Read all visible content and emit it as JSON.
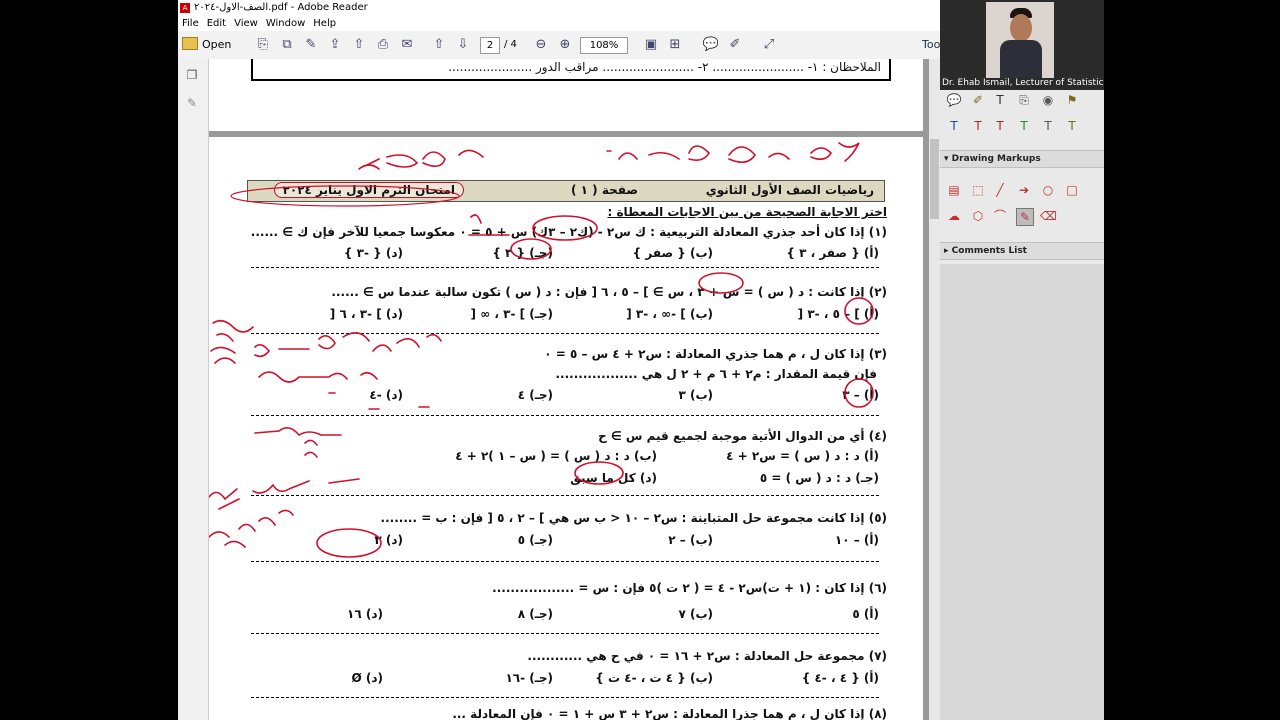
{
  "window": {
    "title": "الصف-الاول-٢٠٢٤.pdf - Adobe Reader"
  },
  "menu": [
    "File",
    "Edit",
    "View",
    "Window",
    "Help"
  ],
  "toolbar": {
    "open_label": "Open",
    "page_current": "2",
    "page_total": "/ 4",
    "zoom": "108%",
    "tools_label": "Too"
  },
  "page1": {
    "notes_line": "الملاحظان : ١- ........................ ٢- ........................      مراقب الدور ......................"
  },
  "exam": {
    "header_subject": "رياضيات الصف الأول الثانوي",
    "header_page": "صفحة ( ١ )",
    "header_title": "امتحان الترم الاول يناير ٢٠٢٤",
    "instruction": "اختر الاجابة الصحيحة من بين الاجابات المعطاة :",
    "questions": [
      {
        "stem": "(١) إذا كان أحد جذري المعادلة التربيعية : ك س٢ - (ك٢ – ٣ك) س + ٥ = ٠ معكوسا جمعيا للآخر فإن ك ∋ ......",
        "options": [
          "(أ) { صفر ، ٣ }",
          "(ب) { صفر }",
          "(جـ) { ٣ }",
          "(د) { -٣ }"
        ]
      },
      {
        "stem": "(٢) إذا كانت : د ( س ) = س + ٣ ، س ∋ ] – ٥ ، ٦ [ فإن : د ( س ) تكون سالبة عندما س ∋ ......",
        "options": [
          "(أ) ] – ٥ ، -٣ [",
          "(ب) ] -∞ ، -٣ [",
          "(جـ) ] -٣ ، ∞ [",
          "(د) ] -٣ ، ٦ ["
        ]
      },
      {
        "stem": "(٣) إذا كان ل ، م هما جذري المعادلة : س٢ + ٤ س – ٥ = ٠",
        "stem2": "فإن قيمة المقدار : م٢ + ٦ م + ٢ ل هي ..................",
        "options": [
          "(أ) – ٣",
          "(ب) ٣",
          "(جـ) ٤",
          "(د) -٤"
        ]
      },
      {
        "stem": "(٤) أي من الدوال الأتية موجبة لجميع قيم س ∋ ح",
        "options": [
          "(أ) د : د ( س ) = س٢ + ٤",
          "(ب) د : د ( س ) = ( س – ١ )٢ + ٤",
          "(جـ) د : د ( س ) = ٥",
          "(د) كل ما سبق"
        ]
      },
      {
        "stem": "(٥) إذا كانت مجموعة حل المتباينة : س٢ – ١٠ < ب س هي ] – ٢ ، ٥ [ فإن : ب = ........",
        "options": [
          "(أ) – ١٠",
          "(ب) – ٢",
          "(جـ) ٥",
          "(د) ٣"
        ]
      },
      {
        "stem": "(٦) إذا كان : (١ + ت)س٢ - ٤ = ( ٢ ت )٥ فإن : س = ..................",
        "options": [
          "(أ) ٥",
          "(ب) ٧",
          "(جـ) ٨",
          "(د) ١٦"
        ]
      },
      {
        "stem": "(٧) مجموعة حل المعادلة : س٢ + ١٦ = ٠ في ح هي ............",
        "options": [
          "(أ) { ٤ ، -٤ }",
          "(ب) { ٤ ت ، -٤ ت }",
          "(جـ) -١٦",
          "(د) Ø"
        ]
      },
      {
        "stem": "(٨) إذا كان ل ، م هما جذرا المعادلة : س٢ + ٣ س + ١ = ٠ فإن المعادلة ..."
      }
    ]
  },
  "presenter": {
    "caption": "Dr. Ehab Ismail, Lecturer of Statistics"
  },
  "right_panel": {
    "drawing_markups": "Drawing Markups",
    "comments_list": "Comments List"
  },
  "colors": {
    "ink": "#d0102a",
    "header_band": "#ddd8c0"
  }
}
